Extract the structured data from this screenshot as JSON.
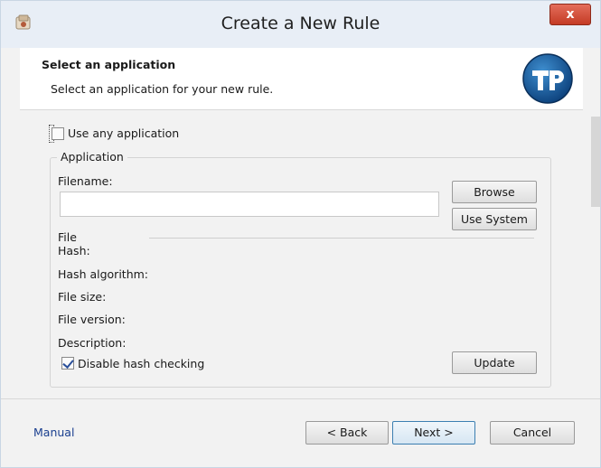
{
  "window": {
    "title": "Create a New Rule",
    "close_glyph": "x",
    "accent": "#c43b25"
  },
  "header": {
    "title": "Select an application",
    "subtitle": "Select an application for your new rule."
  },
  "options": {
    "use_any_application_label": "Use any application",
    "use_any_application_checked": false
  },
  "application_group": {
    "label": "Application",
    "filename_label": "Filename:",
    "filename_value": "",
    "browse_label": "Browse",
    "use_system_label": "Use System",
    "file_label": "File",
    "hash_label": "Hash:",
    "hash_algorithm_label": "Hash algorithm:",
    "file_size_label": "File size:",
    "file_version_label": "File version:",
    "description_label": "Description:",
    "disable_hash_label": "Disable hash checking",
    "disable_hash_checked": true,
    "update_label": "Update"
  },
  "footer": {
    "manual_label": "Manual",
    "back_label": "< Back",
    "next_label": "Next >",
    "cancel_label": "Cancel"
  },
  "icons": {
    "app": "app-icon",
    "logo": "brand-logo-icon",
    "close": "close-icon",
    "checkbox": "checkbox-icon"
  }
}
